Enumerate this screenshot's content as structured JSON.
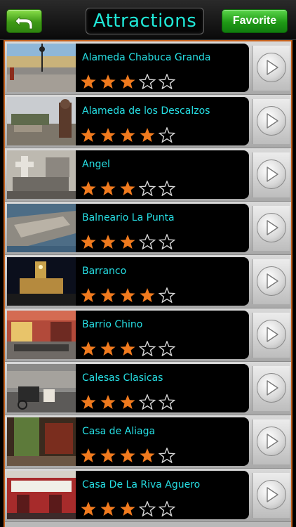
{
  "header": {
    "back_icon": "back-arrow-icon",
    "title": "Attractions",
    "favorite_label": "Favorite"
  },
  "colors": {
    "title": "#20e8d8",
    "name": "#26dfe4",
    "star_filled": "#f07a1e",
    "button_green": "#2f8410",
    "frame_orange": "#c5611d"
  },
  "items": [
    {
      "name": "Alameda Chabuca Granda",
      "rating": 3,
      "max_rating": 5,
      "thumb_icon": "photo-plaza-thumbnail"
    },
    {
      "name": "Alameda de los Descalzos",
      "rating": 4,
      "max_rating": 5,
      "thumb_icon": "photo-statue-thumbnail"
    },
    {
      "name": "Angel",
      "rating": 3,
      "max_rating": 5,
      "thumb_icon": "photo-cemetery-thumbnail"
    },
    {
      "name": "Balneario La Punta",
      "rating": 3,
      "max_rating": 5,
      "thumb_icon": "photo-coast-thumbnail"
    },
    {
      "name": "Barranco",
      "rating": 4,
      "max_rating": 5,
      "thumb_icon": "photo-night-building-thumbnail"
    },
    {
      "name": "Barrio Chino",
      "rating": 3,
      "max_rating": 5,
      "thumb_icon": "photo-street-gate-thumbnail"
    },
    {
      "name": "Calesas Clasicas",
      "rating": 3,
      "max_rating": 5,
      "thumb_icon": "photo-carriage-thumbnail"
    },
    {
      "name": "Casa de Aliaga",
      "rating": 4,
      "max_rating": 5,
      "thumb_icon": "photo-courtyard-thumbnail"
    },
    {
      "name": "Casa De La Riva Aguero",
      "rating": 3,
      "max_rating": 5,
      "thumb_icon": "photo-red-balcony-thumbnail"
    }
  ]
}
